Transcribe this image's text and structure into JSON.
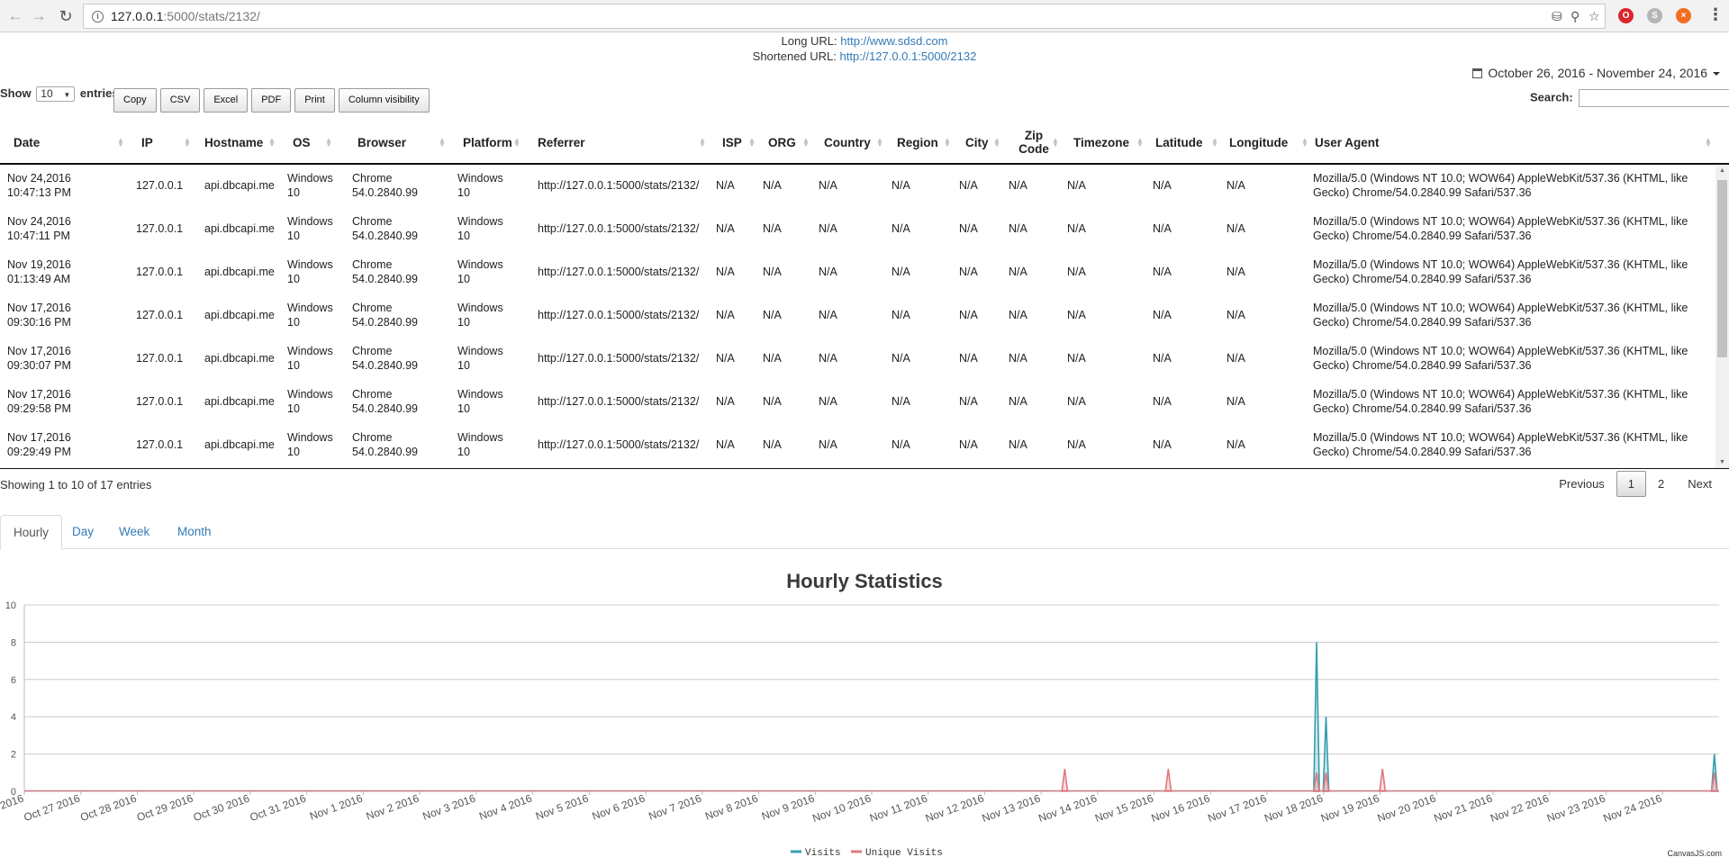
{
  "browser": {
    "url_host": "127.0.0.1",
    "url_rest": ":5000/stats/2132/",
    "icons": [
      "back-arrow-icon",
      "forward-arrow-icon",
      "reload-icon",
      "info-icon",
      "no-cookies-icon",
      "zoom-icon",
      "star-icon",
      "opera-extension-icon",
      "skype-extension-icon",
      "close-extension-icon",
      "menu-icon"
    ]
  },
  "link_info": {
    "long_label": "Long URL:",
    "long_url": "http://www.sdsd.com",
    "short_label": "Shortened URL:",
    "short_url": "http://127.0.0.1:5000/2132"
  },
  "date_range": "October 26, 2016 - November 24, 2016",
  "length": {
    "show": "Show",
    "value": "10",
    "entries": "entries"
  },
  "buttons": [
    "Copy",
    "CSV",
    "Excel",
    "PDF",
    "Print",
    "Column visibility"
  ],
  "search_label": "Search:",
  "table": {
    "columns": [
      "Date",
      "IP",
      "Hostname",
      "OS",
      "Browser",
      "Platform",
      "Referrer",
      "ISP",
      "ORG",
      "Country",
      "Region",
      "City",
      "Zip Code",
      "Timezone",
      "Latitude",
      "Longitude",
      "User Agent"
    ],
    "rows": [
      [
        "Nov 24,2016 10:47:13 PM",
        "127.0.0.1",
        "api.dbcapi.me",
        "Windows 10",
        "Chrome 54.0.2840.99",
        "Windows 10",
        "http://127.0.0.1:5000/stats/2132/",
        "N/A",
        "N/A",
        "N/A",
        "N/A",
        "N/A",
        "N/A",
        "N/A",
        "N/A",
        "N/A",
        "Mozilla/5.0 (Windows NT 10.0; WOW64) AppleWebKit/537.36 (KHTML, like Gecko) Chrome/54.0.2840.99 Safari/537.36"
      ],
      [
        "Nov 24,2016 10:47:11 PM",
        "127.0.0.1",
        "api.dbcapi.me",
        "Windows 10",
        "Chrome 54.0.2840.99",
        "Windows 10",
        "http://127.0.0.1:5000/stats/2132/",
        "N/A",
        "N/A",
        "N/A",
        "N/A",
        "N/A",
        "N/A",
        "N/A",
        "N/A",
        "N/A",
        "Mozilla/5.0 (Windows NT 10.0; WOW64) AppleWebKit/537.36 (KHTML, like Gecko) Chrome/54.0.2840.99 Safari/537.36"
      ],
      [
        "Nov 19,2016 01:13:49 AM",
        "127.0.0.1",
        "api.dbcapi.me",
        "Windows 10",
        "Chrome 54.0.2840.99",
        "Windows 10",
        "http://127.0.0.1:5000/stats/2132/",
        "N/A",
        "N/A",
        "N/A",
        "N/A",
        "N/A",
        "N/A",
        "N/A",
        "N/A",
        "N/A",
        "Mozilla/5.0 (Windows NT 10.0; WOW64) AppleWebKit/537.36 (KHTML, like Gecko) Chrome/54.0.2840.99 Safari/537.36"
      ],
      [
        "Nov 17,2016 09:30:16 PM",
        "127.0.0.1",
        "api.dbcapi.me",
        "Windows 10",
        "Chrome 54.0.2840.99",
        "Windows 10",
        "http://127.0.0.1:5000/stats/2132/",
        "N/A",
        "N/A",
        "N/A",
        "N/A",
        "N/A",
        "N/A",
        "N/A",
        "N/A",
        "N/A",
        "Mozilla/5.0 (Windows NT 10.0; WOW64) AppleWebKit/537.36 (KHTML, like Gecko) Chrome/54.0.2840.99 Safari/537.36"
      ],
      [
        "Nov 17,2016 09:30:07 PM",
        "127.0.0.1",
        "api.dbcapi.me",
        "Windows 10",
        "Chrome 54.0.2840.99",
        "Windows 10",
        "http://127.0.0.1:5000/stats/2132/",
        "N/A",
        "N/A",
        "N/A",
        "N/A",
        "N/A",
        "N/A",
        "N/A",
        "N/A",
        "N/A",
        "Mozilla/5.0 (Windows NT 10.0; WOW64) AppleWebKit/537.36 (KHTML, like Gecko) Chrome/54.0.2840.99 Safari/537.36"
      ],
      [
        "Nov 17,2016 09:29:58 PM",
        "127.0.0.1",
        "api.dbcapi.me",
        "Windows 10",
        "Chrome 54.0.2840.99",
        "Windows 10",
        "http://127.0.0.1:5000/stats/2132/",
        "N/A",
        "N/A",
        "N/A",
        "N/A",
        "N/A",
        "N/A",
        "N/A",
        "N/A",
        "N/A",
        "Mozilla/5.0 (Windows NT 10.0; WOW64) AppleWebKit/537.36 (KHTML, like Gecko) Chrome/54.0.2840.99 Safari/537.36"
      ],
      [
        "Nov 17,2016 09:29:49 PM",
        "127.0.0.1",
        "api.dbcapi.me",
        "Windows 10",
        "Chrome 54.0.2840.99",
        "Windows 10",
        "http://127.0.0.1:5000/stats/2132/",
        "N/A",
        "N/A",
        "N/A",
        "N/A",
        "N/A",
        "N/A",
        "N/A",
        "N/A",
        "N/A",
        "Mozilla/5.0 (Windows NT 10.0; WOW64) AppleWebKit/537.36 (KHTML, like Gecko) Chrome/54.0.2840.99 Safari/537.36"
      ]
    ]
  },
  "info": "Showing 1 to 10 of 17 entries",
  "pagination": {
    "previous": "Previous",
    "pages": [
      "1",
      "2"
    ],
    "current": "1",
    "next": "Next"
  },
  "tabs": [
    {
      "label": "Hourly",
      "active": true
    },
    {
      "label": "Day",
      "active": false
    },
    {
      "label": "Week",
      "active": false
    },
    {
      "label": "Month",
      "active": false
    }
  ],
  "chart_data": {
    "type": "area",
    "title": "Hourly Statistics",
    "x_tick_labels": [
      "2016",
      "Oct 27 2016",
      "Oct 28 2016",
      "Oct 29 2016",
      "Oct 30 2016",
      "Oct 31 2016",
      "Nov 1 2016",
      "Nov 2 2016",
      "Nov 3 2016",
      "Nov 4 2016",
      "Nov 5 2016",
      "Nov 6 2016",
      "Nov 7 2016",
      "Nov 8 2016",
      "Nov 9 2016",
      "Nov 10 2016",
      "Nov 11 2016",
      "Nov 12 2016",
      "Nov 13 2016",
      "Nov 14 2016",
      "Nov 15 2016",
      "Nov 16 2016",
      "Nov 17 2016",
      "Nov 18 2016",
      "Nov 19 2016",
      "Nov 20 2016",
      "Nov 21 2016",
      "Nov 22 2016",
      "Nov 23 2016",
      "Nov 24 2016"
    ],
    "x_range": [
      "2016-10-26",
      "2016-11-25"
    ],
    "y_ticks": [
      0,
      2,
      4,
      6,
      8,
      10
    ],
    "ylim": [
      0,
      10
    ],
    "grid": true,
    "legend_position": "bottom-center",
    "credit": "CanvasJS.com",
    "series": [
      {
        "name": "Visits",
        "color": "#369ead",
        "points": [
          {
            "x": "2016-11-17 21:00",
            "y": 8
          },
          {
            "x": "2016-11-18 01:00",
            "y": 4
          },
          {
            "x": "2016-11-24 22:00",
            "y": 2
          }
        ]
      },
      {
        "name": "Unique Visits",
        "color": "#e0787f",
        "points": [
          {
            "x": "2016-11-13 10:00",
            "y": 1.2
          },
          {
            "x": "2016-11-15 06:00",
            "y": 1.2
          },
          {
            "x": "2016-11-17 21:00",
            "y": 1
          },
          {
            "x": "2016-11-18 01:00",
            "y": 1
          },
          {
            "x": "2016-11-19 01:00",
            "y": 1.2
          },
          {
            "x": "2016-11-24 22:00",
            "y": 1
          }
        ]
      }
    ]
  }
}
